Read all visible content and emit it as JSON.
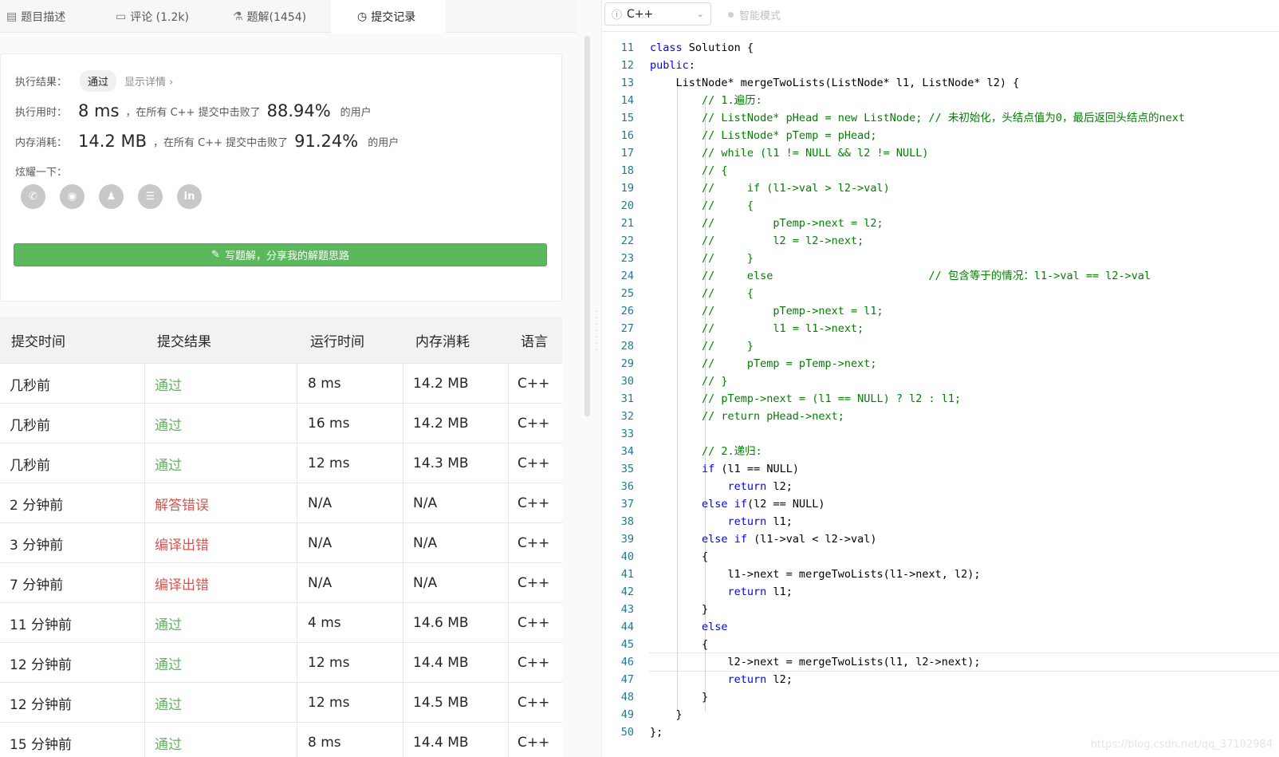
{
  "tabs": [
    {
      "label": "题目描述",
      "icon": "description-icon"
    },
    {
      "label": "评论 (1.2k)",
      "icon": "comment-icon"
    },
    {
      "label": "题解(1454)",
      "icon": "flask-icon"
    },
    {
      "label": "提交记录",
      "icon": "clock-icon"
    }
  ],
  "result": {
    "exec_label": "执行结果：",
    "status": "通过",
    "detail_link": "显示详情 ›",
    "time_label": "执行用时：",
    "time_value": "8 ms",
    "time_text": "，在所有 C++ 提交中击败了",
    "time_pct": "88.94%",
    "users_text": "的用户",
    "mem_label": "内存消耗：",
    "mem_value": "14.2 MB",
    "mem_text": "，在所有 C++ 提交中击败了",
    "mem_pct": "91.24%",
    "share_label": "炫耀一下：",
    "share_icons": [
      "wechat-icon",
      "weibo-icon",
      "qq-icon",
      "douban-icon",
      "linkedin-icon"
    ],
    "write_button": "写题解，分享我的解题思路"
  },
  "table": {
    "headers": [
      "提交时间",
      "提交结果",
      "运行时间",
      "内存消耗",
      "语言"
    ],
    "rows": [
      [
        "几秒前",
        "通过",
        "8 ms",
        "14.2 MB",
        "C++"
      ],
      [
        "几秒前",
        "通过",
        "16 ms",
        "14.2 MB",
        "C++"
      ],
      [
        "几秒前",
        "通过",
        "12 ms",
        "14.3 MB",
        "C++"
      ],
      [
        "2 分钟前",
        "解答错误",
        "N/A",
        "N/A",
        "C++"
      ],
      [
        "3 分钟前",
        "编译出错",
        "N/A",
        "N/A",
        "C++"
      ],
      [
        "7 分钟前",
        "编译出错",
        "N/A",
        "N/A",
        "C++"
      ],
      [
        "11 分钟前",
        "通过",
        "4 ms",
        "14.6 MB",
        "C++"
      ],
      [
        "12 分钟前",
        "通过",
        "12 ms",
        "14.4 MB",
        "C++"
      ],
      [
        "12 分钟前",
        "通过",
        "12 ms",
        "14.5 MB",
        "C++"
      ],
      [
        "15 分钟前",
        "通过",
        "8 ms",
        "14.4 MB",
        "C++"
      ]
    ]
  },
  "editor": {
    "language": "C++",
    "smart_mode": "智能模式",
    "lines": [
      {
        "n": "11",
        "t": "class Solution {"
      },
      {
        "n": "12",
        "t": "public:"
      },
      {
        "n": "13",
        "t": "    ListNode* mergeTwoLists(ListNode* l1, ListNode* l2) {"
      },
      {
        "n": "14",
        "t": "        // 1.遍历:"
      },
      {
        "n": "15",
        "t": "        // ListNode* pHead = new ListNode; // 未初始化，头结点值为0，最后返回头结点的next"
      },
      {
        "n": "16",
        "t": "        // ListNode* pTemp = pHead;"
      },
      {
        "n": "17",
        "t": "        // while (l1 != NULL && l2 != NULL)"
      },
      {
        "n": "18",
        "t": "        // {"
      },
      {
        "n": "19",
        "t": "        //     if (l1->val > l2->val)"
      },
      {
        "n": "20",
        "t": "        //     {"
      },
      {
        "n": "21",
        "t": "        //         pTemp->next = l2;"
      },
      {
        "n": "22",
        "t": "        //         l2 = l2->next;"
      },
      {
        "n": "23",
        "t": "        //     }"
      },
      {
        "n": "24",
        "t": "        //     else                        // 包含等于的情况：l1->val == l2->val"
      },
      {
        "n": "25",
        "t": "        //     {"
      },
      {
        "n": "26",
        "t": "        //         pTemp->next = l1;"
      },
      {
        "n": "27",
        "t": "        //         l1 = l1->next;"
      },
      {
        "n": "28",
        "t": "        //     }"
      },
      {
        "n": "29",
        "t": "        //     pTemp = pTemp->next;"
      },
      {
        "n": "30",
        "t": "        // }"
      },
      {
        "n": "31",
        "t": "        // pTemp->next = (l1 == NULL) ? l2 : l1;"
      },
      {
        "n": "32",
        "t": "        // return pHead->next;"
      },
      {
        "n": "33",
        "t": ""
      },
      {
        "n": "34",
        "t": "        // 2.递归:"
      },
      {
        "n": "35",
        "t": "        if (l1 == NULL)"
      },
      {
        "n": "36",
        "t": "            return l2;"
      },
      {
        "n": "37",
        "t": "        else if(l2 == NULL)"
      },
      {
        "n": "38",
        "t": "            return l1;"
      },
      {
        "n": "39",
        "t": "        else if (l1->val < l2->val)"
      },
      {
        "n": "40",
        "t": "        {"
      },
      {
        "n": "41",
        "t": "            l1->next = mergeTwoLists(l1->next, l2);"
      },
      {
        "n": "42",
        "t": "            return l1;"
      },
      {
        "n": "43",
        "t": "        }"
      },
      {
        "n": "44",
        "t": "        else"
      },
      {
        "n": "45",
        "t": "        {"
      },
      {
        "n": "46",
        "t": "            l2->next = mergeTwoLists(l1, l2->next);"
      },
      {
        "n": "47",
        "t": "            return l2;"
      },
      {
        "n": "48",
        "t": "        }"
      },
      {
        "n": "49",
        "t": "    }"
      },
      {
        "n": "50",
        "t": "};"
      }
    ]
  },
  "watermark": "https://blog.csdn.net/qq_37102984",
  "colors": {
    "pass": "#5cb85c",
    "error": "#d9534f",
    "button": "#5cb85c",
    "keyword": "#0000ff",
    "comment": "#008000",
    "line_number": "#237893"
  }
}
